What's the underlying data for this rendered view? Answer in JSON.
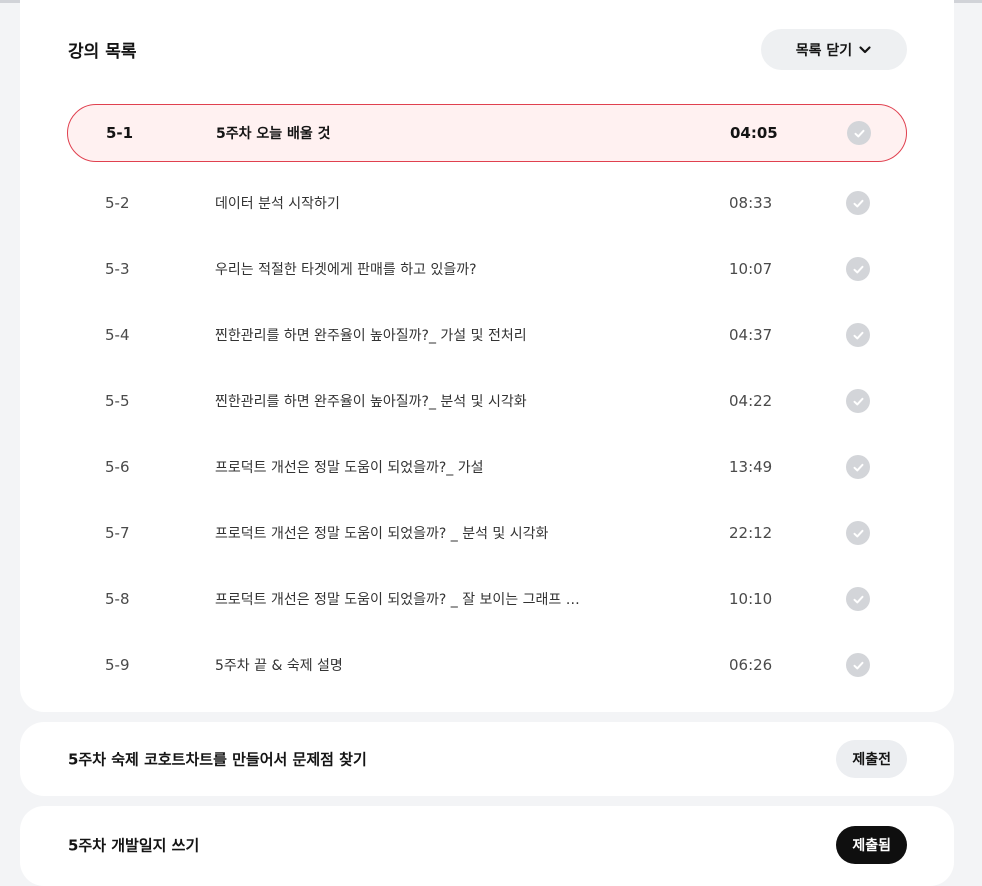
{
  "lecture_list": {
    "title": "강의 목록",
    "close_button_label": "목록 닫기",
    "items": [
      {
        "num": "5-1",
        "title": "5주차 오늘 배울 것",
        "duration": "04:05",
        "active": true
      },
      {
        "num": "5-2",
        "title": "데이터 분석 시작하기",
        "duration": "08:33",
        "active": false
      },
      {
        "num": "5-3",
        "title": "우리는 적절한 타겟에게 판매를 하고 있을까?",
        "duration": "10:07",
        "active": false
      },
      {
        "num": "5-4",
        "title": "찐한관리를 하면 완주율이 높아질까?_ 가설 및 전처리",
        "duration": "04:37",
        "active": false
      },
      {
        "num": "5-5",
        "title": "찐한관리를 하면 완주율이 높아질까?_ 분석 및 시각화",
        "duration": "04:22",
        "active": false
      },
      {
        "num": "5-6",
        "title": "프로덕트 개선은 정말 도움이 되었을까?_ 가설",
        "duration": "13:49",
        "active": false
      },
      {
        "num": "5-7",
        "title": "프로덕트 개선은 정말 도움이 되었을까? _ 분석 및 시각화",
        "duration": "22:12",
        "active": false
      },
      {
        "num": "5-8",
        "title": "프로덕트 개선은 정말 도움이 되었을까? _ 잘 보이는 그래프 …",
        "duration": "10:10",
        "active": false
      },
      {
        "num": "5-9",
        "title": "5주차 끝 & 숙제 설명",
        "duration": "06:26",
        "active": false
      }
    ]
  },
  "homework": {
    "title": "5주차 숙제 코호트차트를 만들어서 문제점 찾기",
    "status": "제출전"
  },
  "devlog": {
    "title": "5주차 개발일지 쓰기",
    "status": "제출됨"
  },
  "colors": {
    "active_border": "#e0404f",
    "active_bg": "#fff1f1",
    "check_gray": "#d3d5d9",
    "submitted_badge": "#0f0f0f"
  }
}
